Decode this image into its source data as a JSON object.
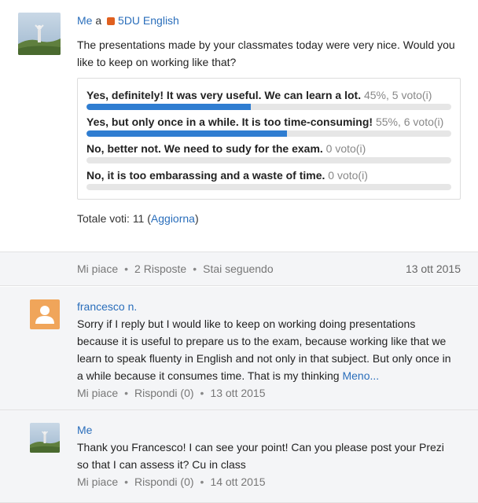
{
  "post": {
    "author": "Me",
    "connector": "a",
    "group": "5DU English",
    "text": "The presentations made by your classmates today were very nice. Would you like to keep on working like that?",
    "poll": [
      {
        "label": "Yes, definitely! It was very useful. We can learn a lot.",
        "meta": "45%, 5 voto(i)",
        "percent": 45
      },
      {
        "label": "Yes, but only once in a while. It is too time-consuming!",
        "meta": "55%, 6 voto(i)",
        "percent": 55
      },
      {
        "label": "No, better not. We need to sudy for the exam.",
        "meta": "0 voto(i)",
        "percent": 0
      },
      {
        "label": "No, it is too embarassing and a waste of time.",
        "meta": "0 voto(i)",
        "percent": 0
      }
    ],
    "total_prefix": "Totale voti: 11 (",
    "refresh": "Aggiorna",
    "total_suffix": ")"
  },
  "actions": {
    "like": "Mi piace",
    "replies": "2 Risposte",
    "following": "Stai seguendo",
    "date": "13 ott 2015"
  },
  "replies": [
    {
      "author": "francesco n.",
      "text": "Sorry if I reply but I would like to keep on working doing presentations because it is useful to prepare us to the exam, because working like that we learn to speak fluenty in English and not only in that subject. But only once in a while because it consumes time. That is my thinking",
      "more": "Meno...",
      "like": "Mi piace",
      "reply": "Rispondi (0)",
      "date": "13 ott 2015"
    },
    {
      "author": "Me",
      "text": "Thank you Francesco! I can see your point! Can you please post your Prezi so that I can assess it? Cu in class",
      "like": "Mi piace",
      "reply": "Rispondi (0)",
      "date": "14 ott 2015"
    }
  ],
  "colors": {
    "accent": "#2a6ebb",
    "bar_fill": "#2f7dd1",
    "group": "#e0601f",
    "avatar_default": "#f0a55a"
  }
}
